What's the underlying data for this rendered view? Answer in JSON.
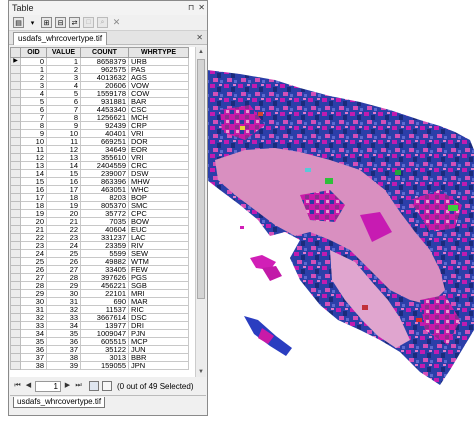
{
  "window": {
    "title": "Table",
    "active_tab": "usdafs_whrcovertype.tif",
    "bottom_tab": "usdafs_whrcovertype.tif"
  },
  "table": {
    "columns": [
      "OID",
      "VALUE",
      "COUNT",
      "WHRTYPE"
    ],
    "rows": [
      [
        "0",
        "1",
        "8658379",
        "URB"
      ],
      [
        "1",
        "2",
        "962575",
        "PAS"
      ],
      [
        "2",
        "3",
        "4013632",
        "AGS"
      ],
      [
        "3",
        "4",
        "20606",
        "VOW"
      ],
      [
        "4",
        "5",
        "1559178",
        "COW"
      ],
      [
        "5",
        "6",
        "931881",
        "BAR"
      ],
      [
        "6",
        "7",
        "4453340",
        "CSC"
      ],
      [
        "7",
        "8",
        "1256621",
        "MCH"
      ],
      [
        "8",
        "9",
        "92439",
        "CRP"
      ],
      [
        "9",
        "10",
        "40401",
        "VRI"
      ],
      [
        "10",
        "11",
        "669251",
        "DOR"
      ],
      [
        "11",
        "12",
        "34649",
        "EOR"
      ],
      [
        "12",
        "13",
        "355610",
        "VRI"
      ],
      [
        "13",
        "14",
        "2404559",
        "CRC"
      ],
      [
        "14",
        "15",
        "239007",
        "DSW"
      ],
      [
        "15",
        "16",
        "863396",
        "MHW"
      ],
      [
        "16",
        "17",
        "463051",
        "WHC"
      ],
      [
        "17",
        "18",
        "8203",
        "BOP"
      ],
      [
        "18",
        "19",
        "805370",
        "SMC"
      ],
      [
        "19",
        "20",
        "35772",
        "CPC"
      ],
      [
        "20",
        "21",
        "7035",
        "BOW"
      ],
      [
        "21",
        "22",
        "40604",
        "EUC"
      ],
      [
        "22",
        "23",
        "331237",
        "LAC"
      ],
      [
        "23",
        "24",
        "23359",
        "RIV"
      ],
      [
        "24",
        "25",
        "5599",
        "SEW"
      ],
      [
        "25",
        "26",
        "49882",
        "WTM"
      ],
      [
        "26",
        "27",
        "33405",
        "FEW"
      ],
      [
        "27",
        "28",
        "397626",
        "PGS"
      ],
      [
        "28",
        "29",
        "456221",
        "SGB"
      ],
      [
        "29",
        "30",
        "22101",
        "MRI"
      ],
      [
        "30",
        "31",
        "690",
        "MAR"
      ],
      [
        "31",
        "32",
        "11537",
        "RIC"
      ],
      [
        "32",
        "33",
        "3667614",
        "DSC"
      ],
      [
        "33",
        "34",
        "13977",
        "DRI"
      ],
      [
        "34",
        "35",
        "1009047",
        "PJN"
      ],
      [
        "35",
        "36",
        "605515",
        "MCP"
      ],
      [
        "36",
        "37",
        "35122",
        "JUN"
      ],
      [
        "37",
        "38",
        "3013",
        "BBR"
      ],
      [
        "38",
        "39",
        "159055",
        "JPN"
      ]
    ]
  },
  "status": {
    "page": "1",
    "selected_text": "(0 out of 49 Selected)"
  },
  "icons": {
    "title_buttons": [
      "pin-icon",
      "close-icon"
    ],
    "toolbar": [
      "table-options-icon",
      "dropdown-icon",
      "related-tables-icon",
      "select-by-attributes-icon",
      "switch-selection-icon",
      "clear-selection-icon",
      "zoom-to-selected-icon",
      "delete-selected-icon"
    ]
  },
  "colors": {
    "urban_pink": "#d98fc0",
    "forest_blue": "#2a3fa8",
    "sage_magenta": "#d019b8",
    "water_white": "#ffffff"
  }
}
